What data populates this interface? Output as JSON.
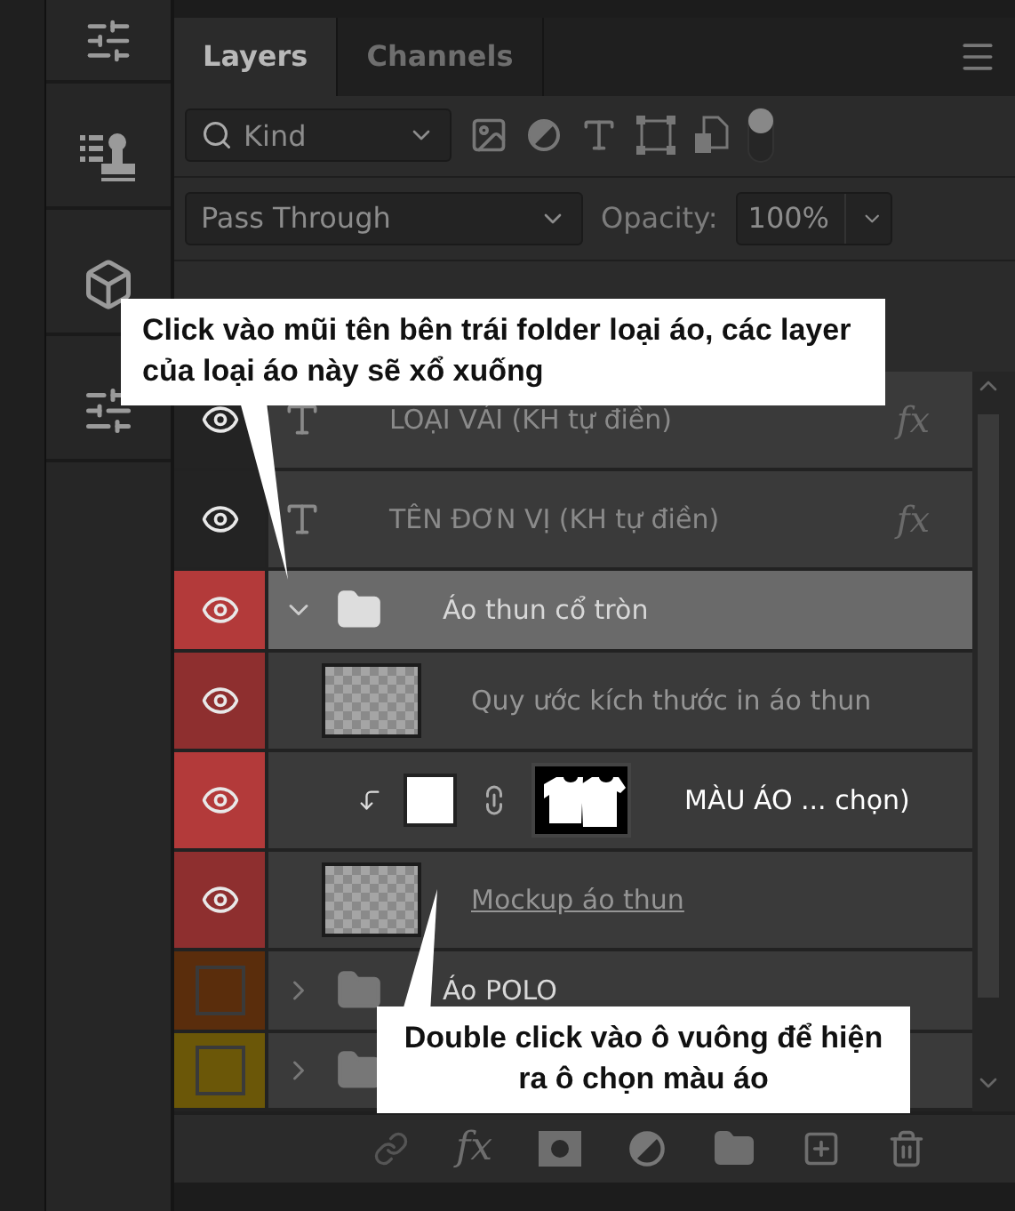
{
  "tabs": [
    {
      "label": "Layers",
      "selected": true
    },
    {
      "label": "Channels",
      "selected": false
    }
  ],
  "filter": {
    "value": "Kind"
  },
  "blend": {
    "mode": "Pass Through",
    "opacity_label": "Opacity:",
    "opacity": "100%"
  },
  "layers": [
    {
      "kind": "text",
      "name": "LOẠI VẢI (KH tự điền)",
      "visible": true,
      "color": "#232323",
      "selected": false,
      "fx": "fx"
    },
    {
      "kind": "text",
      "name": "TÊN ĐƠN VỊ (KH tự điền)",
      "visible": true,
      "color": "#232323",
      "selected": false,
      "fx": "fx"
    },
    {
      "kind": "group",
      "name": "Áo thun cổ tròn",
      "visible": true,
      "color": "#b33a3a",
      "selected": true,
      "expanded": true,
      "children": [
        {
          "kind": "pixel",
          "name": "Quy ước kích thước in áo thun",
          "visible": true,
          "color": "#8e2f2f",
          "selected": false,
          "underlined": false
        },
        {
          "kind": "fill",
          "name": "MÀU ÁO ... chọn)",
          "visible": true,
          "color": "#b33a3a",
          "selected": false
        },
        {
          "kind": "pixel",
          "name": "Mockup áo thun",
          "visible": true,
          "color": "#8e2f2f",
          "selected": false,
          "underlined": true
        }
      ]
    },
    {
      "kind": "group",
      "name": "Áo POLO",
      "visible": false,
      "color": "#5a2d0c",
      "selected": false,
      "expanded": false
    },
    {
      "kind": "group",
      "visible": false,
      "color": "#6b5708",
      "selected": false,
      "expanded": false
    }
  ],
  "toolbar": {
    "fx": "fx"
  },
  "callouts": [
    {
      "text": "Click vào mũi tên bên trái folder loại áo, các layer của loại áo này sẽ xổ xuống"
    },
    {
      "text": "Double click vào ô vuông để hiện ra ô chọn màu áo"
    }
  ]
}
